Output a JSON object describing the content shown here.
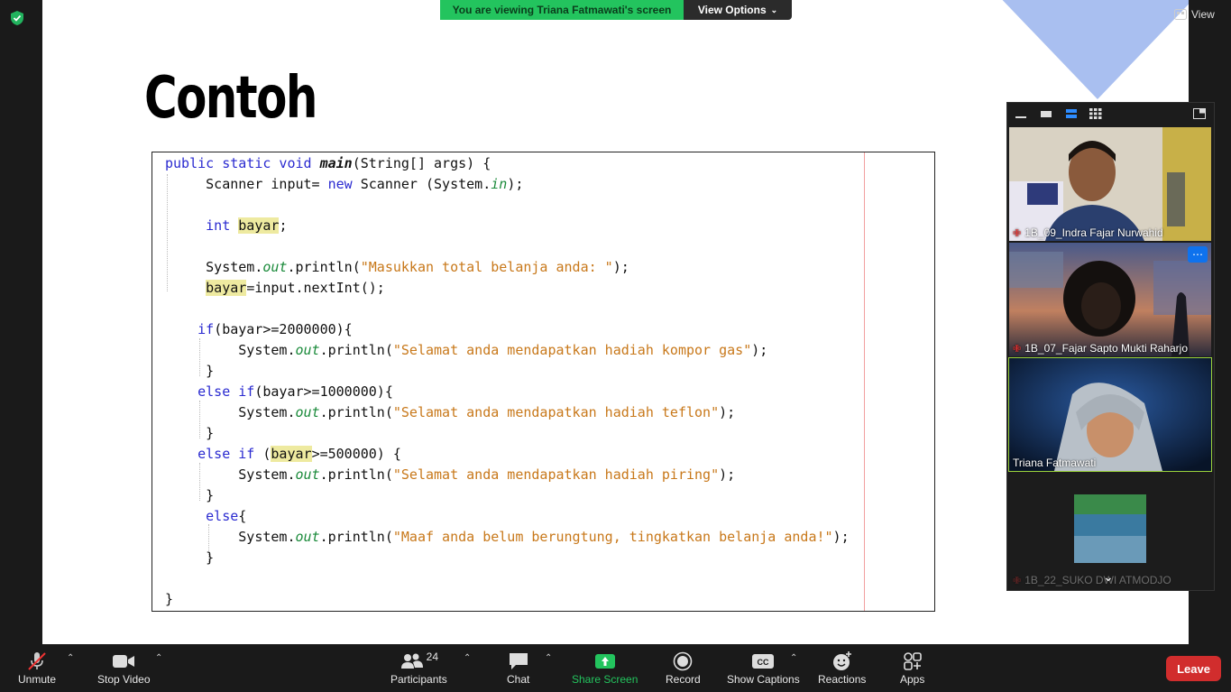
{
  "banner": {
    "viewing_text": "You are viewing Triana Fatmawati's screen",
    "view_options": "View Options",
    "view_button": "View"
  },
  "slide": {
    "title": "Contoh",
    "code": [
      "public static void main(String[] args) {",
      "    Scanner input= new Scanner (System.in);",
      "int bayar;",
      "System.out.println(\"Masukkan total belanja anda: \");",
      "bayar=input.nextInt();",
      "if(bayar>=2000000){",
      "System.out.println(\"Selamat anda mendapatkan hadiah kompor gas\");",
      "}",
      "else if(bayar>=1000000){",
      "System.out.println(\"Selamat anda mendapatkan hadiah teflon\");",
      "}",
      "else if (bayar>=500000) {",
      "System.out.println(\"Selamat anda mendapatkan hadiah piring\");",
      "}",
      "else{",
      "System.out.println(\"Maaf anda belum berungtung, tingkatkan belanja anda!\");",
      "}",
      "}"
    ]
  },
  "participants_panel": {
    "tiles": [
      {
        "name": "1B_09_Indra Fajar Nurwahid",
        "muted": true
      },
      {
        "name": "1B_07_Fajar Sapto Mukti Raharjo",
        "muted": true
      },
      {
        "name": "Triana Fatmawati",
        "muted": false
      },
      {
        "name": "1B_22_SUKO DWI ATMODJO",
        "muted": true
      }
    ]
  },
  "toolbar": {
    "unmute": "Unmute",
    "stop_video": "Stop Video",
    "participants": "Participants",
    "participants_count": "24",
    "chat": "Chat",
    "share_screen": "Share Screen",
    "record": "Record",
    "show_captions": "Show Captions",
    "reactions": "Reactions",
    "apps": "Apps",
    "leave": "Leave"
  },
  "colors": {
    "share_green": "#23c45e",
    "leave_red": "#d12d2d",
    "accent_blue": "#0e72ed",
    "speaker_border": "#9bd23c"
  }
}
